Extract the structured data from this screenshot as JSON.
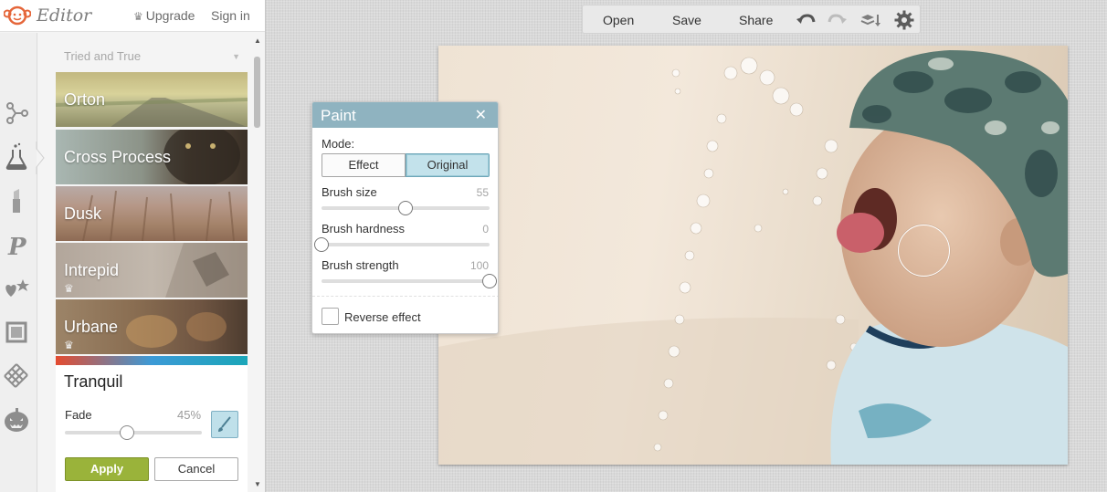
{
  "header": {
    "app_title": "Editor",
    "upgrade_label": "Upgrade",
    "signin_label": "Sign in"
  },
  "effects_panel": {
    "category": "Tried and True",
    "effects": [
      {
        "label": "Orton",
        "premium": false
      },
      {
        "label": "Cross Process",
        "premium": false
      },
      {
        "label": "Dusk",
        "premium": false
      },
      {
        "label": "Intrepid",
        "premium": true
      },
      {
        "label": "Urbane",
        "premium": true
      }
    ],
    "active_effect": {
      "title": "Tranquil",
      "fade_label": "Fade",
      "fade_value_text": "45%",
      "fade_fraction": 0.45,
      "apply_label": "Apply",
      "cancel_label": "Cancel"
    }
  },
  "toolbar": {
    "open_label": "Open",
    "save_label": "Save",
    "share_label": "Share",
    "icons": [
      "undo-icon",
      "redo-icon",
      "layers-icon",
      "gear-icon"
    ]
  },
  "paint_dialog": {
    "title": "Paint",
    "mode_label": "Mode:",
    "mode_options": [
      "Effect",
      "Original"
    ],
    "mode_selected": "Original",
    "sliders": [
      {
        "label": "Brush size",
        "value": "55",
        "fraction": 0.5
      },
      {
        "label": "Brush hardness",
        "value": "0",
        "fraction": 0.0
      },
      {
        "label": "Brush strength",
        "value": "100",
        "fraction": 1.0
      }
    ],
    "reverse_label": "Reverse effect",
    "reverse_checked": false
  },
  "colors": {
    "dialog_header": "#8fb3c0",
    "apply_button": "#9ab33a",
    "selected_mode": "#c3e2eb"
  }
}
